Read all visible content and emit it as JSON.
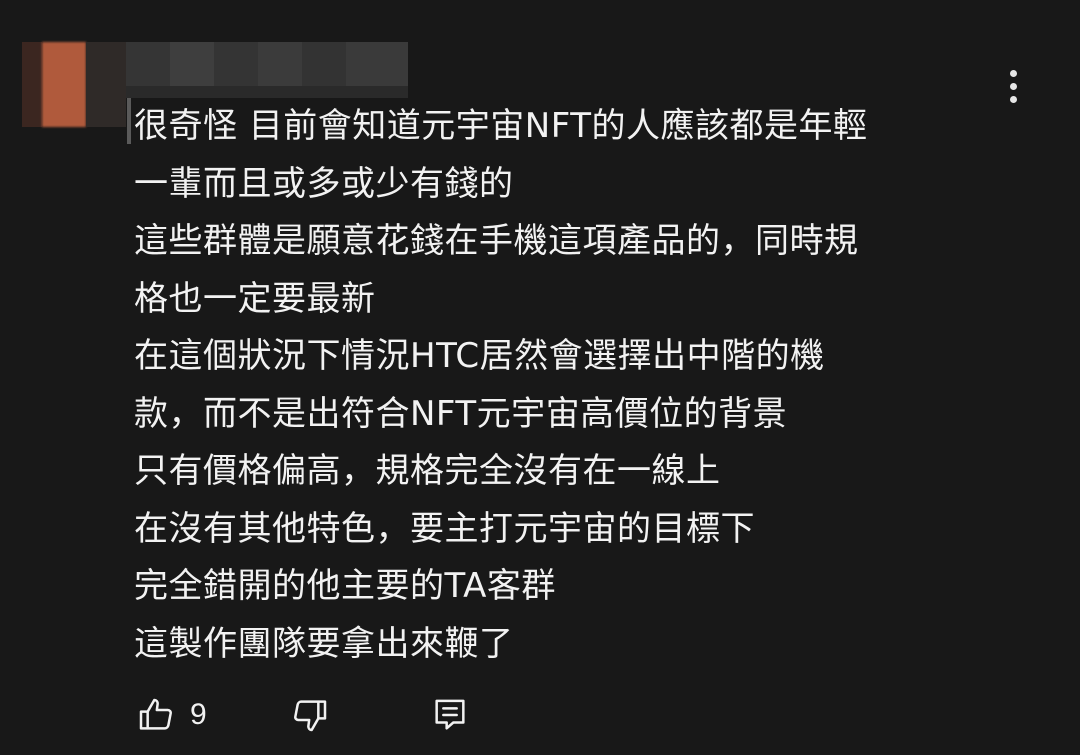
{
  "comment": {
    "lines": [
      "很奇怪 目前會知道元宇宙NFT的人應該都是年輕",
      "一輩而且或多或少有錢的",
      "這些群體是願意花錢在手機這項產品的，同時規",
      "格也一定要最新",
      "在這個狀況下情況HTC居然會選擇出中階的機",
      "款，而不是出符合NFT元宇宙高價位的背景",
      "只有價格偏高，規格完全沒有在一線上",
      "在沒有其他特色，要主打元宇宙的目標下",
      "完全錯開的他主要的TA客群",
      "這製作團隊要拿出來鞭了"
    ],
    "like_count": "9"
  },
  "icons": {
    "like": "thumbs-up-icon",
    "dislike": "thumbs-down-icon",
    "reply": "reply-comment-icon",
    "more": "more-vert-icon"
  },
  "colors": {
    "background": "#181818",
    "text": "#f1f1f1",
    "avatar": "#b05a3c"
  }
}
